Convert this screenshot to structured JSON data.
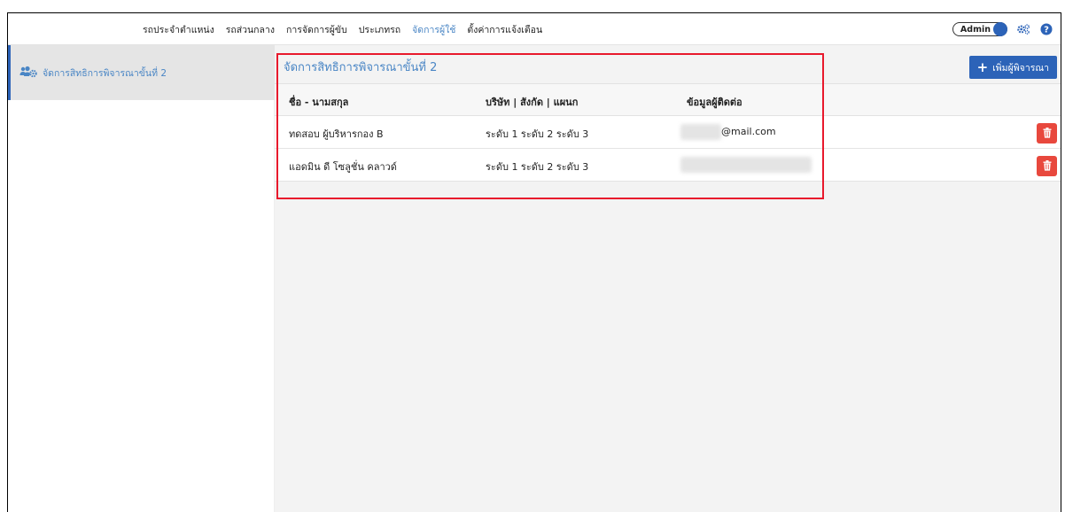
{
  "nav": {
    "items": [
      {
        "label": "รถประจำตำแหน่ง",
        "active": false
      },
      {
        "label": "รถส่วนกลาง",
        "active": false
      },
      {
        "label": "การจัดการผู้ขับ",
        "active": false
      },
      {
        "label": "ประเภทรถ",
        "active": false
      },
      {
        "label": "จัดการผู้ใช้",
        "active": true
      },
      {
        "label": "ตั้งค่าการแจ้งเตือน",
        "active": false
      }
    ],
    "admin_label": "Admin",
    "icons": [
      "gear-icon",
      "help-icon"
    ]
  },
  "sidebar": {
    "items": [
      {
        "label": "จัดการสิทธิการพิจารณาขั้นที่ 2",
        "icon": "users-cog-icon",
        "selected": true
      }
    ]
  },
  "main": {
    "title": "จัดการสิทธิการพิจารณาขั้นที่ 2",
    "add_button_label": "เพิ่มผู้พิจารณา",
    "columns": [
      "ชื่อ - นามสกุล",
      "บริษัท | สังกัด | แผนก",
      "ข้อมูลผู้ติดต่อ"
    ],
    "rows": [
      {
        "name": "ทดสอบ ผู้บริหารกอง B",
        "org": "ระดับ 1 ระดับ 2 ระดับ 3",
        "contact_suffix": "@mail.com"
      },
      {
        "name": "แอดมิน ดี โซลูชั่น คลาวด์",
        "org": "ระดับ 1 ระดับ 2 ระดับ 3",
        "contact_suffix": ""
      }
    ]
  },
  "colors": {
    "accent": "#2c63b8",
    "link": "#4a86c5",
    "danger": "#e8483d",
    "highlight": "#e8192c"
  }
}
